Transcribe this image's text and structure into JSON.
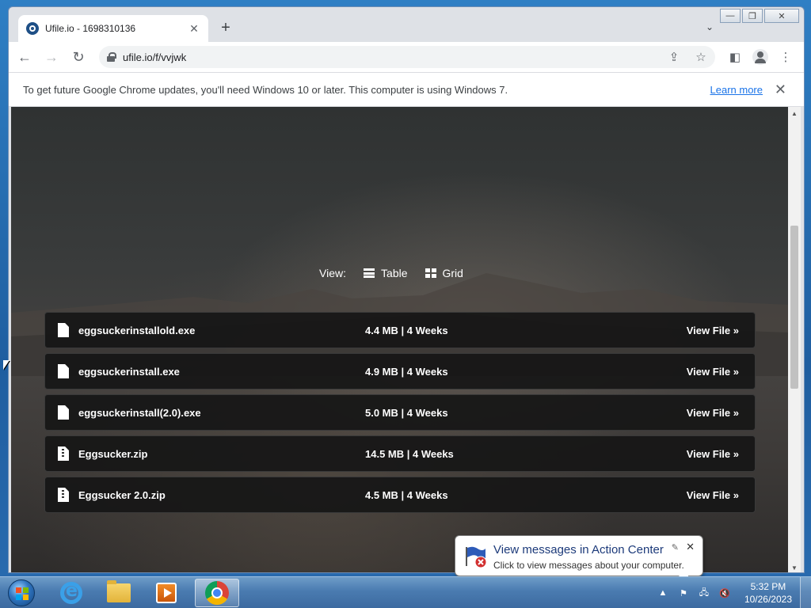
{
  "browser": {
    "tab_title": "Ufile.io - 1698310136",
    "tab_close": "✕",
    "new_tab": "+",
    "url": "ufile.io/f/vvjwk",
    "infobar_text": "To get future Google Chrome updates, you'll need Windows 10 or later. This computer is using Windows 7.",
    "learn_more": "Learn more",
    "infobar_close": "✕"
  },
  "page": {
    "view_label": "View:",
    "view_table": "Table",
    "view_grid": "Grid",
    "files": [
      {
        "name": "eggsuckerinstallold.exe",
        "meta": "4.4 MB | 4 Weeks",
        "action": "View File »",
        "icon": "file-icon"
      },
      {
        "name": "eggsuckerinstall.exe",
        "meta": "4.9 MB | 4 Weeks",
        "action": "View File »",
        "icon": "file-icon"
      },
      {
        "name": "eggsuckerinstall(2.0).exe",
        "meta": "5.0 MB | 4 Weeks",
        "action": "View File »",
        "icon": "file-icon"
      },
      {
        "name": "Eggsucker.zip",
        "meta": "14.5 MB | 4 Weeks",
        "action": "View File »",
        "icon": "zip-file-icon"
      },
      {
        "name": "Eggsucker 2.0.zip",
        "meta": "4.5 MB | 4 Weeks",
        "action": "View File »",
        "icon": "zip-file-icon"
      }
    ]
  },
  "balloon": {
    "title": "View messages in Action Center",
    "text": "Click to view messages about your computer.",
    "close": "✕"
  },
  "taskbar": {
    "time": "5:32 PM",
    "date": "10/26/2023"
  }
}
